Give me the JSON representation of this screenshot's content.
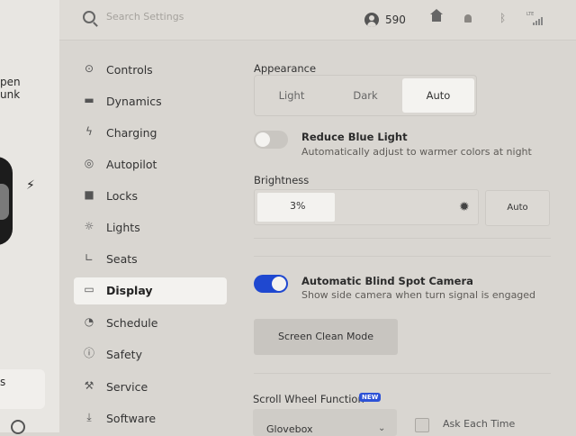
{
  "left_panel": {
    "car_lines": [
      "pen",
      "unk"
    ],
    "card_text": "s"
  },
  "topbar": {
    "search_placeholder": "Search Settings",
    "profile_count": "590",
    "network_label": "LTE"
  },
  "sidebar": {
    "items": [
      {
        "label": "Controls",
        "icon": "toggle-icon"
      },
      {
        "label": "Dynamics",
        "icon": "car-icon"
      },
      {
        "label": "Charging",
        "icon": "lightning-icon"
      },
      {
        "label": "Autopilot",
        "icon": "steering-wheel-icon"
      },
      {
        "label": "Locks",
        "icon": "lock-icon"
      },
      {
        "label": "Lights",
        "icon": "light-icon"
      },
      {
        "label": "Seats",
        "icon": "seat-icon"
      },
      {
        "label": "Display",
        "icon": "display-icon",
        "active": true
      },
      {
        "label": "Schedule",
        "icon": "alarm-clock-icon"
      },
      {
        "label": "Safety",
        "icon": "warning-icon"
      },
      {
        "label": "Service",
        "icon": "wrench-icon"
      },
      {
        "label": "Software",
        "icon": "download-icon"
      }
    ]
  },
  "display": {
    "appearance": {
      "label": "Appearance",
      "options": [
        "Light",
        "Dark",
        "Auto"
      ],
      "selected": "Auto"
    },
    "reduce_blue_light": {
      "title": "Reduce Blue Light",
      "subtitle": "Automatically adjust to warmer colors at night",
      "enabled": false
    },
    "brightness": {
      "label": "Brightness",
      "value": "3%",
      "level_percent": 35,
      "auto_label": "Auto"
    },
    "blind_spot": {
      "title": "Automatic Blind Spot Camera",
      "subtitle": "Show side camera when turn signal is engaged",
      "enabled": true
    },
    "screen_clean_label": "Screen Clean Mode",
    "scroll_wheel": {
      "label": "Scroll Wheel Function",
      "badge": "NEW",
      "selected_option": "Glovebox",
      "ask_each_time_label": "Ask Each Time"
    }
  },
  "colors": {
    "accent": "#1f48d0",
    "background": "#d9d6d1",
    "active_item": "#f3f2ef"
  }
}
